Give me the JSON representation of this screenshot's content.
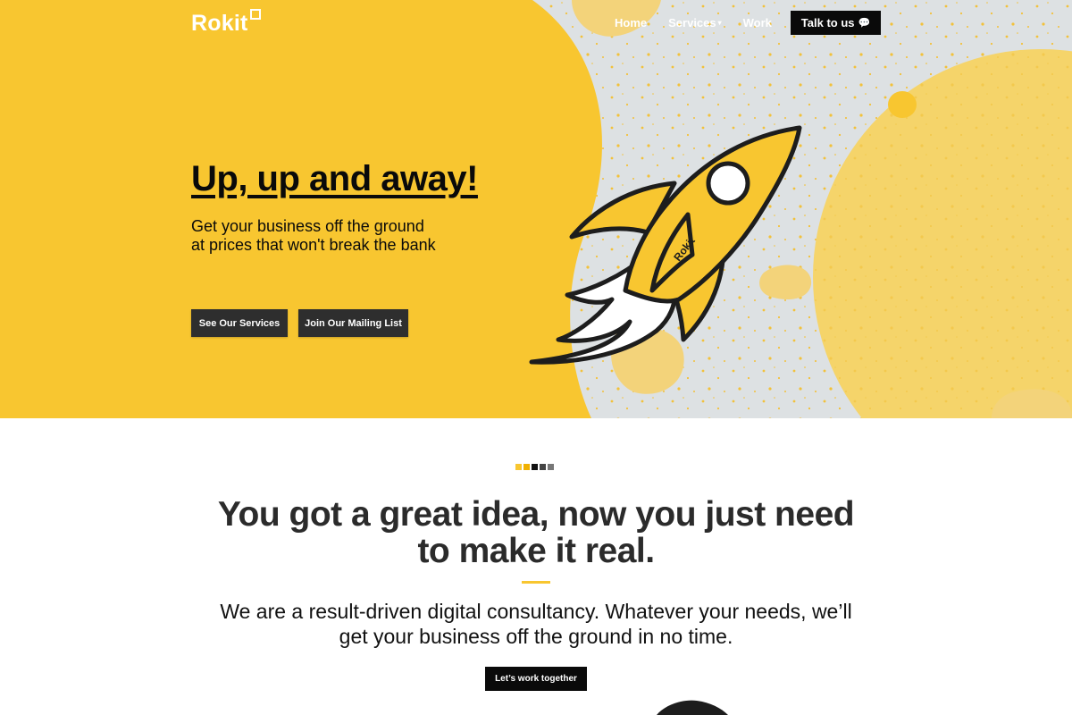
{
  "brand": {
    "name": "Rokit"
  },
  "nav": {
    "home": "Home",
    "services": "Services",
    "work": "Work",
    "talk_button": "Talk to us"
  },
  "hero": {
    "title": "Up, up and away!",
    "subtitle_line1": "Get your business off the ground",
    "subtitle_line2": "at prices that won't break the bank",
    "btn_services": "See Our Services",
    "btn_mailing": "Join Our Mailing List",
    "rocket_logo": "Rokit"
  },
  "intro": {
    "headline_line1": "You got a great idea, now you just need",
    "headline_line2": "to make it real.",
    "lead_line1": "We are a result-driven digital consultancy. Whatever your needs, we’ll",
    "lead_line2": "get your business off the ground in no time.",
    "cta": "Let’s work together"
  },
  "colors": {
    "brand_yellow": "#f8c630",
    "dark": "#0a0a0a",
    "button_gray": "#2e2e2e",
    "space_gray": "#dde1e3",
    "pale_yellow": "#f5d46a"
  },
  "icons": {
    "chat": "speech-bubble-icon",
    "caret": "chevron-down-icon"
  }
}
